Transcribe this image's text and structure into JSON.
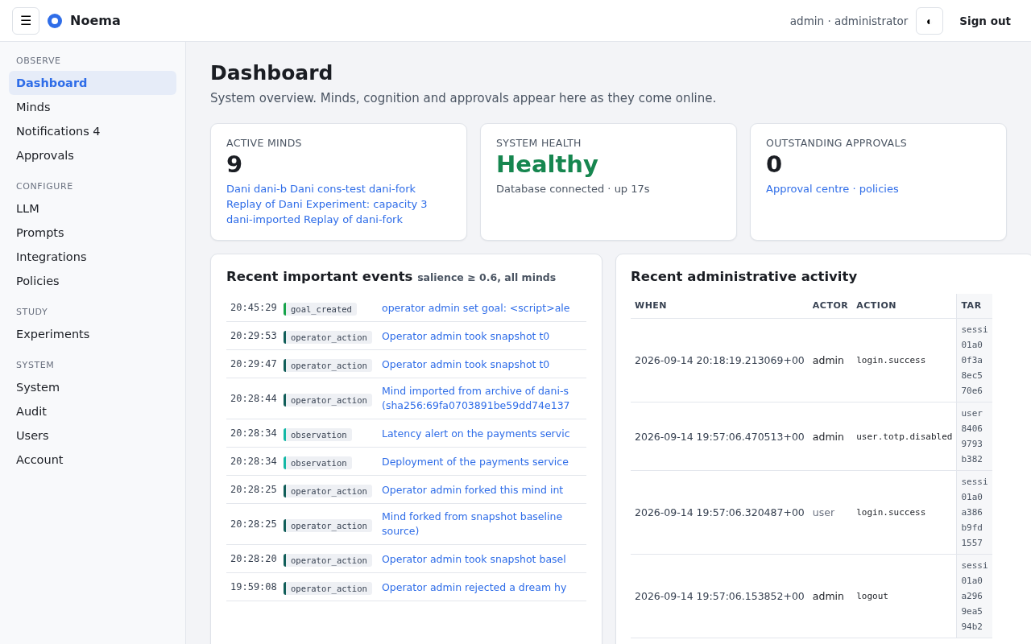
{
  "header": {
    "menu_button": "☰",
    "brand": "Noema",
    "user": "admin · administrator",
    "theme_button": "◐",
    "sign_out": "Sign out"
  },
  "sidebar": [
    {
      "heading": "OBSERVE",
      "items": [
        {
          "label": "Dashboard",
          "selected": true
        },
        {
          "label": "Minds",
          "selected": false
        },
        {
          "label": "Notifications 4",
          "selected": false
        },
        {
          "label": "Approvals",
          "selected": false
        }
      ]
    },
    {
      "heading": "CONFIGURE",
      "items": [
        {
          "label": "LLM",
          "selected": false
        },
        {
          "label": "Prompts",
          "selected": false
        },
        {
          "label": "Integrations",
          "selected": false
        },
        {
          "label": "Policies",
          "selected": false
        }
      ]
    },
    {
      "heading": "STUDY",
      "items": [
        {
          "label": "Experiments",
          "selected": false
        }
      ]
    },
    {
      "heading": "SYSTEM",
      "items": [
        {
          "label": "System",
          "selected": false
        },
        {
          "label": "Audit",
          "selected": false
        },
        {
          "label": "Users",
          "selected": false
        },
        {
          "label": "Account",
          "selected": false
        }
      ]
    }
  ],
  "page": {
    "title": "Dashboard",
    "subtitle": "System overview. Minds, cognition and approvals appear here as they come online."
  },
  "stats": [
    {
      "label": "ACTIVE MINDS",
      "value": "9",
      "kind": "plain",
      "link": "Dani dani-b Dani cons-test dani-fork Replay of Dani Experiment: capacity 3 dani-imported Replay of dani-fork"
    },
    {
      "label": "SYSTEM HEALTH",
      "value": "Healthy",
      "kind": "good",
      "detail": "Database connected · up 17s"
    },
    {
      "label": "OUTSTANDING APPROVALS",
      "value": "0",
      "kind": "plain",
      "link": "Approval centre · policies"
    }
  ],
  "events": {
    "title": "Recent important events",
    "subtitle": "salience ≥ 0.6, all minds",
    "rows": [
      {
        "time": "20:45:29",
        "tag": "goal_created",
        "color": "#16a34a",
        "text": [
          "operator admin set goal: <script>ale"
        ]
      },
      {
        "time": "20:29:53",
        "tag": "operator_action",
        "color": "#115e59",
        "text": [
          "Operator admin took snapshot t0"
        ]
      },
      {
        "time": "20:29:47",
        "tag": "operator_action",
        "color": "#115e59",
        "text": [
          "Operator admin took snapshot t0"
        ]
      },
      {
        "time": "20:28:44",
        "tag": "operator_action",
        "color": "#115e59",
        "text": [
          "Mind imported from archive of dani-s",
          "(sha256:69fa0703891be59dd74e137"
        ]
      },
      {
        "time": "20:28:34",
        "tag": "observation",
        "color": "#14b8a6",
        "text": [
          "Latency alert on the payments servic"
        ]
      },
      {
        "time": "20:28:34",
        "tag": "observation",
        "color": "#14b8a6",
        "text": [
          "Deployment of the payments service"
        ]
      },
      {
        "time": "20:28:25",
        "tag": "operator_action",
        "color": "#115e59",
        "text": [
          "Operator admin forked this mind int"
        ]
      },
      {
        "time": "20:28:25",
        "tag": "operator_action",
        "color": "#115e59",
        "text": [
          "Mind forked from snapshot baseline",
          "source)"
        ]
      },
      {
        "time": "20:28:20",
        "tag": "operator_action",
        "color": "#115e59",
        "text": [
          "Operator admin took snapshot basel"
        ]
      },
      {
        "time": "19:59:08",
        "tag": "operator_action",
        "color": "#115e59",
        "text": [
          "Operator admin rejected a dream hy"
        ]
      }
    ]
  },
  "activity": {
    "title": "Recent administrative activity",
    "columns": [
      "WHEN",
      "ACTOR",
      "ACTION",
      "TAR"
    ],
    "rows": [
      {
        "when": "2026-09-14 20:18:19.213069+00",
        "actor": "admin",
        "actor_muted": false,
        "action": "login.success",
        "target": [
          "sessi",
          "01a0",
          "0f3a",
          "8ec5",
          "70e6"
        ]
      },
      {
        "when": "2026-09-14 19:57:06.470513+00",
        "actor": "admin",
        "actor_muted": false,
        "action": "user.totp.disabled",
        "target": [
          "user",
          "8406",
          "9793",
          "b382"
        ]
      },
      {
        "when": "2026-09-14 19:57:06.320487+00",
        "actor": "user",
        "actor_muted": true,
        "action": "login.success",
        "target": [
          "sessi",
          "01a0",
          "a386",
          "b9fd",
          "1557"
        ]
      },
      {
        "when": "2026-09-14 19:57:06.153852+00",
        "actor": "admin",
        "actor_muted": false,
        "action": "logout",
        "target": [
          "sessi",
          "01a0",
          "a296",
          "9ea5",
          "94b2"
        ]
      }
    ]
  }
}
